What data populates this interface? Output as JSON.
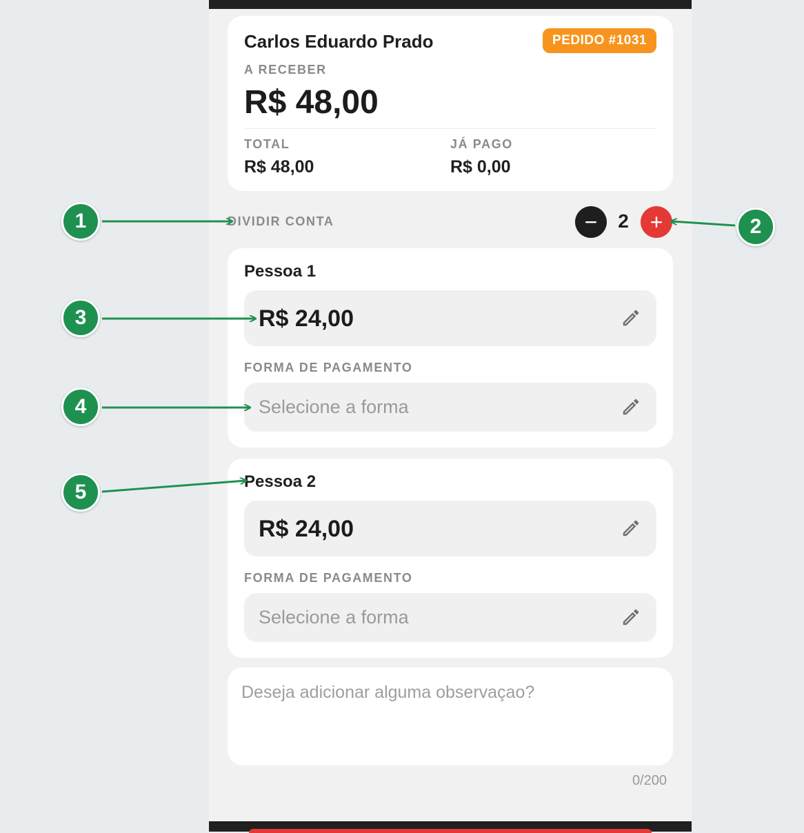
{
  "order": {
    "client_name": "Carlos Eduardo Prado",
    "badge": "PEDIDO #1031",
    "receive_label": "A RECEBER",
    "receive_value": "R$ 48,00",
    "total_label": "TOTAL",
    "total_value": "R$ 48,00",
    "paid_label": "JÁ PAGO",
    "paid_value": "R$ 0,00"
  },
  "split": {
    "label": "DIVIDIR CONTA",
    "count": "2",
    "minus_icon": "minus-icon",
    "plus_icon": "plus-icon"
  },
  "people": [
    {
      "title": "Pessoa 1",
      "amount": "R$ 24,00",
      "payment_label": "FORMA DE PAGAMENTO",
      "payment_placeholder": "Selecione a forma"
    },
    {
      "title": "Pessoa 2",
      "amount": "R$ 24,00",
      "payment_label": "FORMA DE PAGAMENTO",
      "payment_placeholder": "Selecione a forma"
    }
  ],
  "notes": {
    "placeholder": "Deseja adicionar alguma observaçao?",
    "counter": "0/200"
  },
  "annotations": [
    "1",
    "2",
    "3",
    "4",
    "5"
  ],
  "colors": {
    "accent_orange": "#f7941d",
    "accent_red": "#e53935",
    "annotation_green": "#1e9150",
    "dark": "#1e1e1e"
  }
}
